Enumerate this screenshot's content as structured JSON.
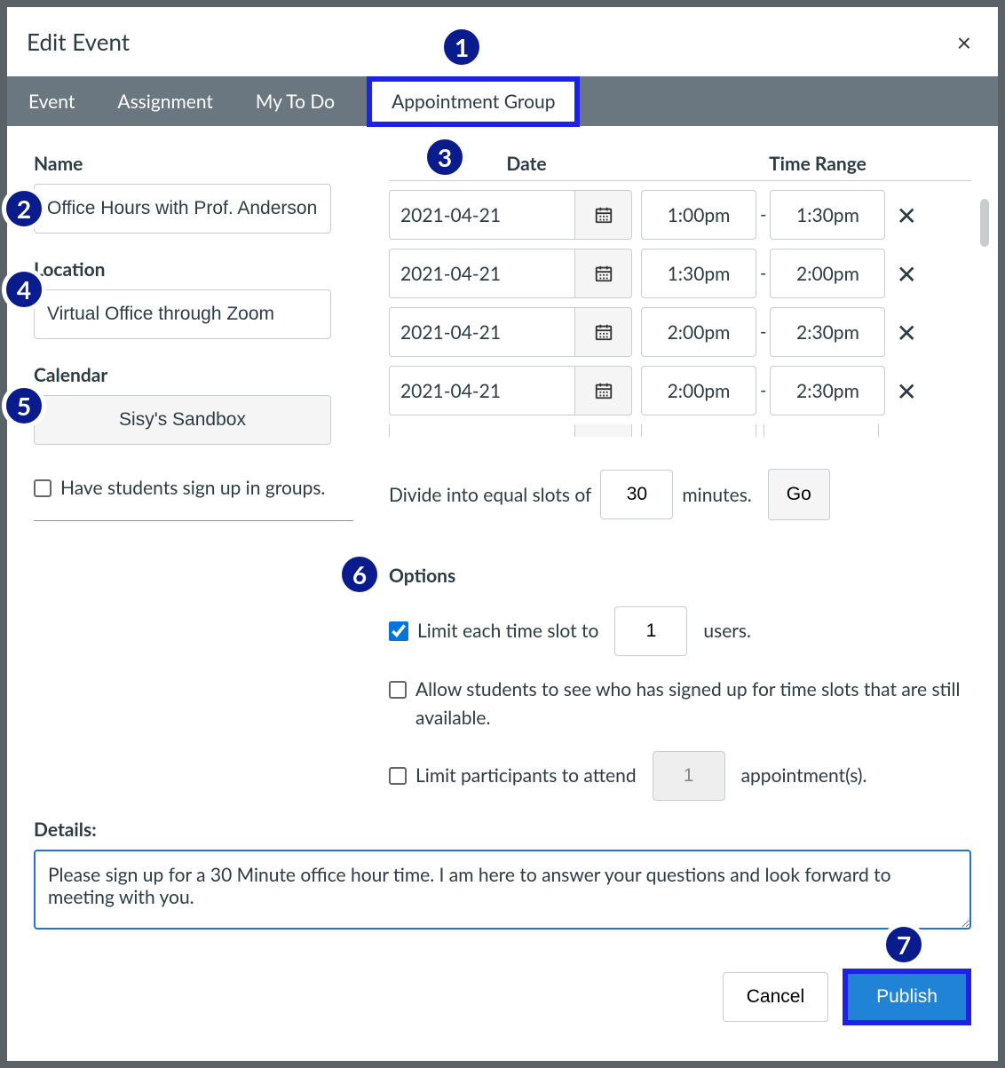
{
  "modal": {
    "title": "Edit Event"
  },
  "tabs": {
    "event": "Event",
    "assignment": "Assignment",
    "todo": "My To Do",
    "appointment": "Appointment Group"
  },
  "labels": {
    "name": "Name",
    "location": "Location",
    "calendar": "Calendar",
    "groups": "Have students sign up in groups.",
    "date_hdr": "Date",
    "time_hdr": "Time Range",
    "divide_pre": "Divide into equal slots of",
    "divide_post": "minutes.",
    "go": "Go",
    "options": "Options",
    "limit_pre": "Limit each time slot to",
    "limit_post": "users.",
    "allow_see": "Allow students to see who has signed up for time slots that are still available.",
    "limit_part_pre": "Limit participants to attend",
    "limit_part_post": "appointment(s).",
    "details": "Details:",
    "cancel": "Cancel",
    "publish": "Publish"
  },
  "values": {
    "name": "Office Hours with Prof. Anderson",
    "location": "Virtual Office through Zoom",
    "calendar": "Sisy's Sandbox",
    "divide_min": "30",
    "limit_users": "1",
    "limit_appts": "1",
    "details": "Please sign up for a 30 Minute office hour time. I am here to answer your questions and look forward to meeting with you."
  },
  "rows": [
    {
      "date": "2021-04-21",
      "start": "1:00pm",
      "end": "1:30pm"
    },
    {
      "date": "2021-04-21",
      "start": "1:30pm",
      "end": "2:00pm"
    },
    {
      "date": "2021-04-21",
      "start": "2:00pm",
      "end": "2:30pm"
    },
    {
      "date": "2021-04-21",
      "start": "2:00pm",
      "end": "2:30pm"
    }
  ],
  "annotations": {
    "a1": "1",
    "a2": "2",
    "a3": "3",
    "a4": "4",
    "a5": "5",
    "a6": "6",
    "a7": "7"
  }
}
